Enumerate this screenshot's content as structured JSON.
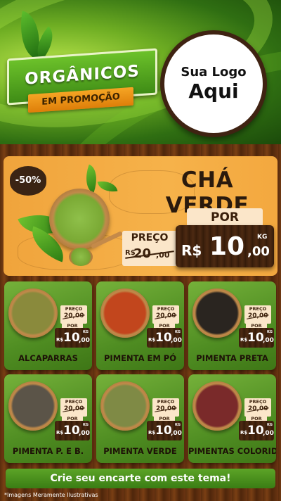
{
  "header": {
    "ribbon_title": "ORGÂNICOS",
    "ribbon_subtitle": "EM PROMOÇÃO",
    "logo_line1": "Sua Logo",
    "logo_line2": "Aqui"
  },
  "featured": {
    "discount": "-50%",
    "title": "CHÁ VERDE",
    "old_label": "PREÇO",
    "old_currency": "R$",
    "old_price": "20",
    "old_cents": ",00",
    "new_label": "POR",
    "currency": "R$",
    "price": "10",
    "cents": ",00",
    "unit": "KG"
  },
  "products": [
    {
      "name": "ALCAPARRAS",
      "color": "#8a8a3c",
      "old_label": "PREÇO",
      "old_price": "20,00",
      "new_label": "POR",
      "currency": "R$",
      "price": "10",
      "cents": ",00",
      "unit": "KG"
    },
    {
      "name": "PIMENTA EM PÓ",
      "color": "#c2461d",
      "old_label": "PREÇO",
      "old_price": "20,00",
      "new_label": "POR",
      "currency": "R$",
      "price": "10",
      "cents": ",00",
      "unit": "KG"
    },
    {
      "name": "PIMENTA PRETA",
      "color": "#2a2520",
      "old_label": "PREÇO",
      "old_price": "20,00",
      "new_label": "POR",
      "currency": "R$",
      "price": "10",
      "cents": ",00",
      "unit": "KG"
    },
    {
      "name": "PIMENTA P. E B.",
      "color": "#5b5448",
      "old_label": "PREÇO",
      "old_price": "20,00",
      "new_label": "POR",
      "currency": "R$",
      "price": "10",
      "cents": ",00",
      "unit": "KG"
    },
    {
      "name": "PIMENTA VERDE",
      "color": "#7f8a45",
      "old_label": "PREÇO",
      "old_price": "20,00",
      "new_label": "POR",
      "currency": "R$",
      "price": "10",
      "cents": ",00",
      "unit": "KG"
    },
    {
      "name": "PIMENTAS COLORIDAS",
      "color": "#7a2a2a",
      "old_label": "PREÇO",
      "old_price": "20,00",
      "new_label": "POR",
      "currency": "R$",
      "price": "10",
      "cents": ",00",
      "unit": "KG"
    }
  ],
  "footer": {
    "cta": "Crie seu encarte com este tema!",
    "disclaimer": "*Imagens Meramente Ilustrativas"
  }
}
